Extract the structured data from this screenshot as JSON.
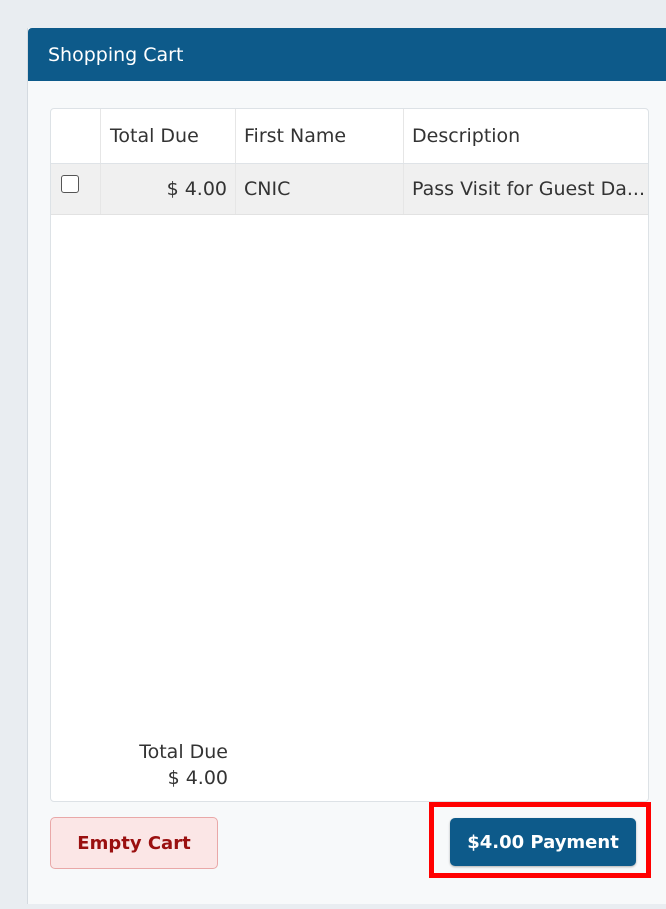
{
  "panel": {
    "title": "Shopping Cart"
  },
  "grid": {
    "columns": [
      "Total Due",
      "First Name",
      "Description"
    ],
    "rows": [
      {
        "checked": false,
        "total_due": "$ 4.00",
        "first_name": "CNIC",
        "description": "Pass Visit for Guest Da..."
      }
    ],
    "footer": {
      "label": "Total Due",
      "value": "$ 4.00"
    }
  },
  "buttons": {
    "empty_cart": "Empty Cart",
    "payment": "$4.00 Payment"
  },
  "colors": {
    "header_bg": "#0d5a8a",
    "payment_bg": "#0d5a8a",
    "empty_cart_bg": "#fbe6e6",
    "empty_cart_text": "#9a1010",
    "highlight": "#ff0000"
  }
}
